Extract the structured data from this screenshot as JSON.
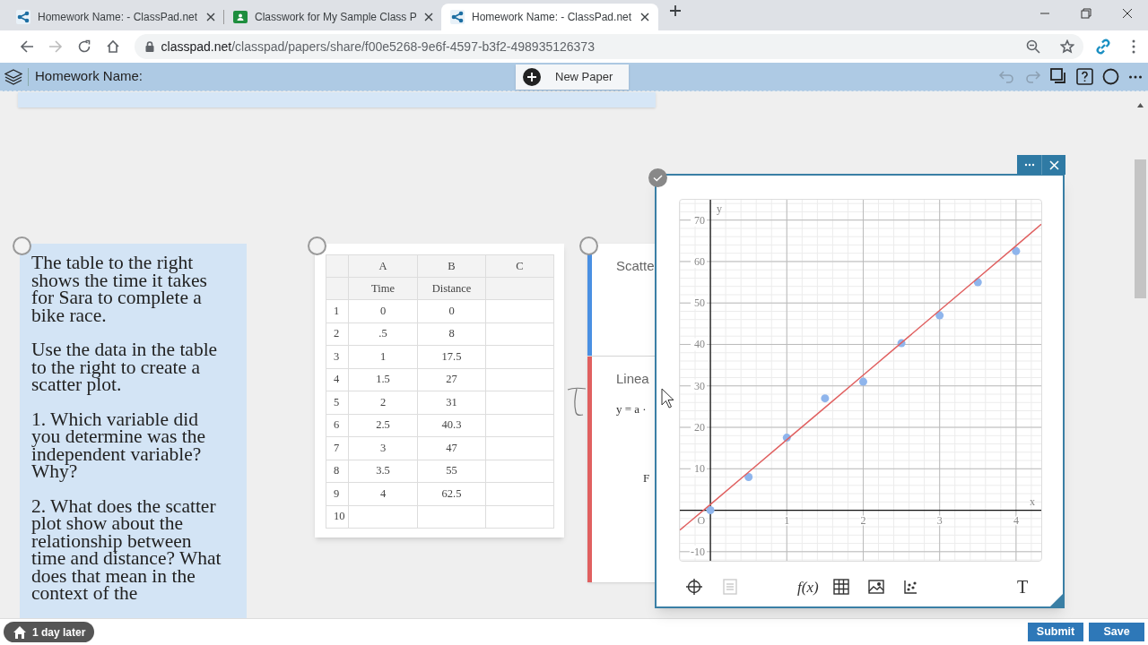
{
  "browser": {
    "tabs": [
      {
        "title": "Homework Name: - ClassPad.net",
        "kind": "classpad",
        "selected": false
      },
      {
        "title": "Classwork for My Sample Class P",
        "kind": "classroom",
        "selected": false
      },
      {
        "title": "Homework Name: - ClassPad.net",
        "kind": "classpad",
        "selected": true
      }
    ],
    "address": {
      "domain": "classpad.net",
      "path": "/classpad/papers/share/f00e5268-9e6f-4597-b3f2-498935126373"
    }
  },
  "app": {
    "title": "Homework Name:",
    "new_paper_button": "New Paper",
    "undo_disabled": true,
    "redo_disabled": true
  },
  "text_card": {
    "paragraphs": [
      "The table to the right shows the time it takes for Sara to complete a bike race.",
      "Use the data in the table to the right to create a scatter plot.",
      "1. Which variable did you determine was the independent variable? Why?",
      "2. What does the scatter plot show about the relationship between time and distance? What does that mean in the context of the"
    ]
  },
  "table_card": {
    "columns": [
      "A",
      "B",
      "C"
    ],
    "header_row": [
      "Time",
      "Distance"
    ],
    "rows": [
      {
        "number": "1",
        "cells": [
          "0",
          "0"
        ]
      },
      {
        "number": "2",
        "cells": [
          ".5",
          "8"
        ]
      },
      {
        "number": "3",
        "cells": [
          "1",
          "17.5"
        ]
      },
      {
        "number": "4",
        "cells": [
          "1.5",
          "27"
        ]
      },
      {
        "number": "5",
        "cells": [
          "2",
          "31"
        ]
      },
      {
        "number": "6",
        "cells": [
          "2.5",
          "40.3"
        ]
      },
      {
        "number": "7",
        "cells": [
          "3",
          "47"
        ]
      },
      {
        "number": "8",
        "cells": [
          "3.5",
          "55"
        ]
      },
      {
        "number": "9",
        "cells": [
          "4",
          "62.5"
        ]
      },
      {
        "number": "10",
        "cells": []
      }
    ]
  },
  "side_cards": [
    {
      "title": "Scatte",
      "color": "#4a90e2"
    },
    {
      "title": "Linea",
      "color": "#e06060",
      "lines": [
        "y = a ·",
        "F"
      ]
    }
  ],
  "graph": {
    "origin_label": "O",
    "chart_data": {
      "type": "scatter",
      "xlabel": "x",
      "ylabel": "y",
      "x": [
        -0.4,
        0,
        0.5,
        1,
        1.5,
        2,
        2.5,
        3,
        3.5,
        4,
        4.33
      ],
      "series": [
        {
          "color": "#8fb5ec",
          "values": [
            null,
            0,
            8,
            17.5,
            27,
            31,
            40.3,
            47,
            55,
            62.5,
            null
          ]
        },
        {
          "type": "line",
          "color": "#e06060",
          "values": [
            -4.8,
            1.4,
            9.2,
            17,
            24.8,
            32.6,
            40.4,
            48.2,
            56,
            63.8,
            69
          ]
        }
      ],
      "grid": true,
      "xlim": [
        -0.4,
        4.33
      ],
      "ylim": [
        -12.2,
        74.9
      ],
      "xticks": [
        1,
        2,
        3,
        4
      ],
      "yticks": [
        -10,
        10,
        20,
        30,
        40,
        50,
        60,
        70
      ]
    },
    "tools": [
      {
        "kind": "crosshair",
        "disabled": false
      },
      {
        "kind": "list",
        "disabled": true
      },
      {
        "kind": "function",
        "label": "f(x)",
        "disabled": false
      },
      {
        "kind": "table",
        "disabled": false
      },
      {
        "kind": "image",
        "disabled": false
      },
      {
        "kind": "scatter",
        "disabled": false
      },
      {
        "kind": "text",
        "label": "T",
        "disabled": false
      }
    ]
  },
  "footer": {
    "deadline": "1 day later",
    "buttons": [
      "Submit",
      "Save"
    ]
  }
}
